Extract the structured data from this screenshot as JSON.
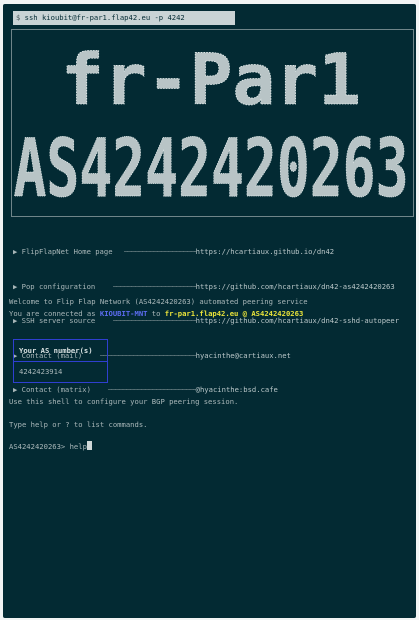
{
  "command": {
    "prompt": "$",
    "text": "ssh kioubit@fr-par1.flap42.eu -p 4242"
  },
  "banner": {
    "line1": "fr-Par1",
    "line2": "AS4242420263"
  },
  "links": [
    {
      "label": "FlipFlapNet Home page",
      "value": "https://hcartiaux.github.io/dn42"
    },
    {
      "label": "Pop configuration",
      "value": "https://github.com/hcartiaux/dn42-as4242420263"
    },
    {
      "label": "SSH server source",
      "value": "https://github.com/hcartiaux/dn42-sshd-autopeer"
    },
    {
      "label": "Contact (mail)",
      "value": "hyacinthe@cartiaux.net"
    },
    {
      "label": "Contact (matrix)",
      "value": "@hyacinthe:bsd.cafe"
    }
  ],
  "welcome": {
    "line1": "Welcome to Flip Flap Network (AS4242420263) automated peering service",
    "connected_prefix": "You are connected as ",
    "user": "KIOUBIT-MNT",
    "connected_mid": " to ",
    "host": "fr-par1.flap42.eu @ AS4242420263"
  },
  "as_box": {
    "header": "Your AS number(s)",
    "value": "4242423914"
  },
  "info": {
    "configure": "Use this shell to configure your BGP peering session.",
    "help_hint": "Type help or ? to list commands."
  },
  "prompt": {
    "text": "AS4242420263> ",
    "input": "help"
  }
}
